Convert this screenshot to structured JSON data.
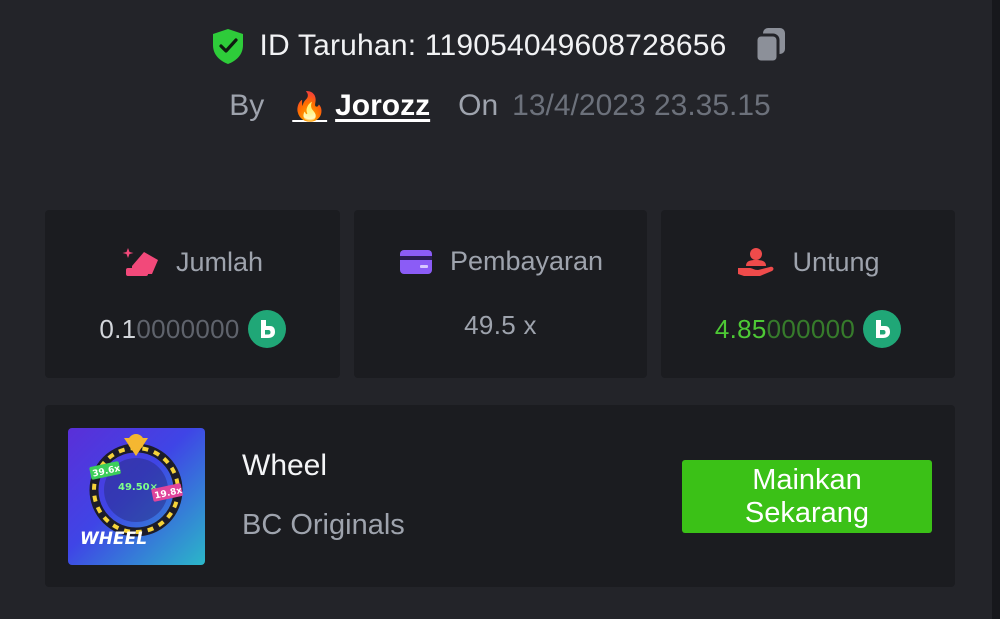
{
  "header": {
    "bet_id_label": "ID Taruhan:",
    "bet_id": "119054049608728656",
    "by_label": "By",
    "username": "Jorozz",
    "on_label": "On",
    "date": "13/4/2023 23.35.15"
  },
  "stats": {
    "amount": {
      "label": "Jumlah",
      "value_main": "0.1",
      "value_zeros": "0000000",
      "icon": "bet-amount-icon"
    },
    "payout": {
      "label": "Pembayaran",
      "value": "49.5 x",
      "icon": "card-icon"
    },
    "profit": {
      "label": "Untung",
      "value_main": "4.85",
      "value_zeros": "000000",
      "icon": "profit-hand-icon"
    }
  },
  "game": {
    "thumb_text": "WHEEL",
    "title": "Wheel",
    "provider": "BC Originals",
    "play_label": "Mainkan\nSekarang"
  },
  "colors": {
    "background": "#232429",
    "card": "#1b1c20",
    "accent_green": "#3bc117",
    "profit_green": "#4dc935",
    "coin": "#20a777"
  }
}
